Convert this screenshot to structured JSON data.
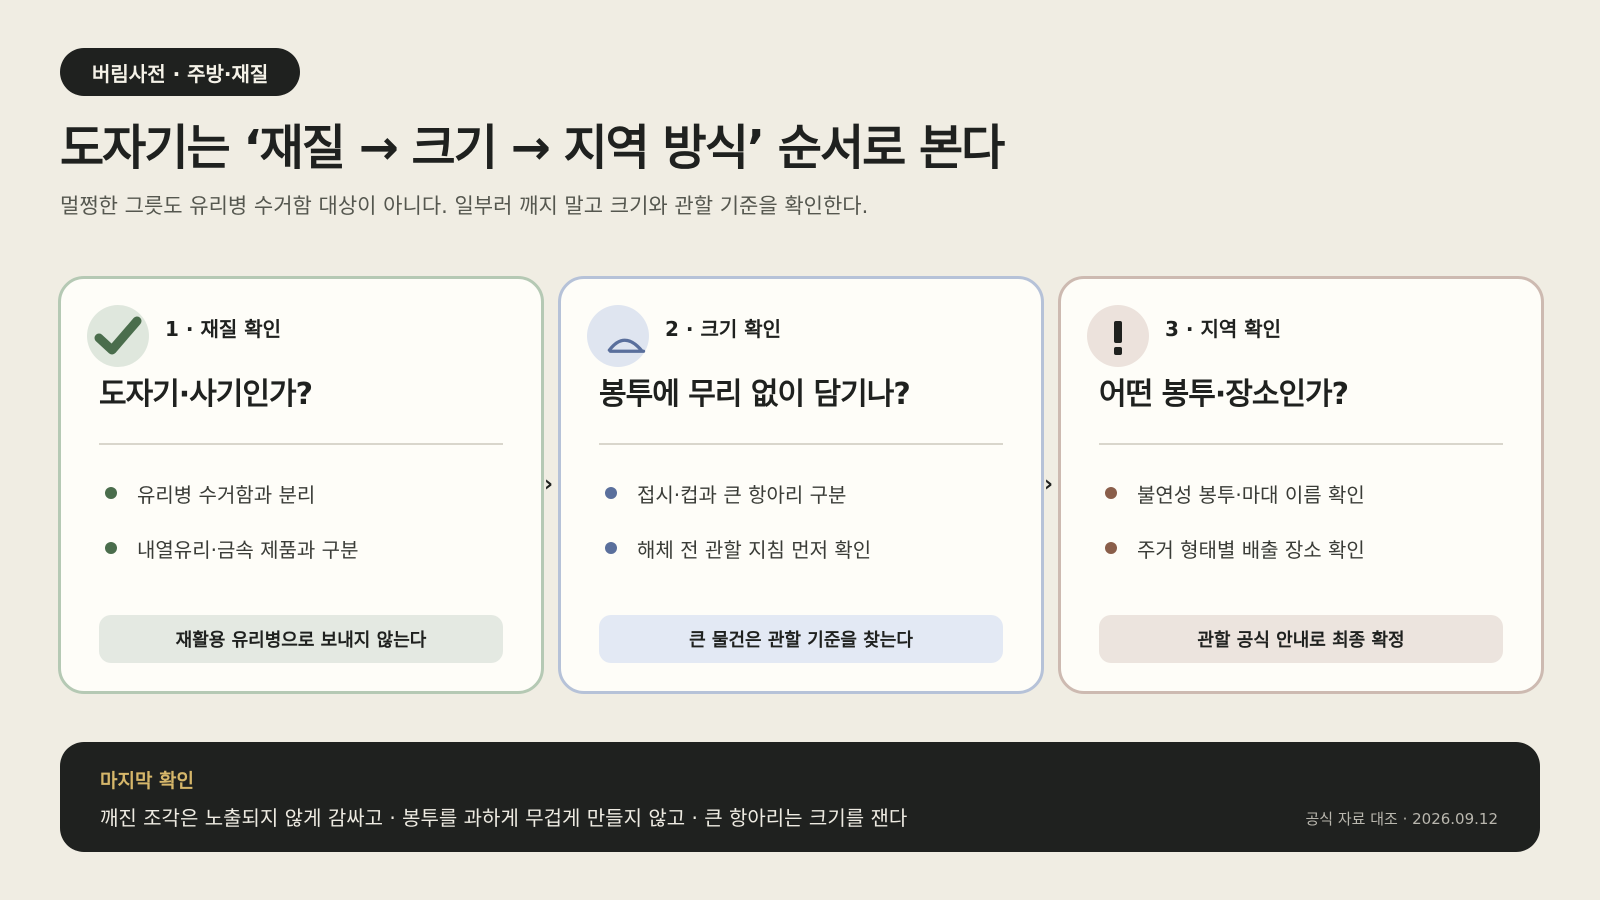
{
  "badge": "버림사전 · 주방·재질",
  "title": "도자기는 ‘재질 → 크기 → 지역 방식’ 순서로 본다",
  "subtitle": "멀쩡한 그릇도 유리병 수거함 대상이 아니다. 일부러 깨지 말고 크기와 관할 기준을 확인한다.",
  "cards": [
    {
      "icon": "check-icon",
      "step": "1 · 재질 확인",
      "question": "도자기·사기인가?",
      "bullets": [
        "유리병 수거함과 분리",
        "내열유리·금속 제품과 구분"
      ],
      "action": "재활용 유리병으로 보내지 않는다",
      "accent": "#4a6d4c"
    },
    {
      "icon": "bowl-icon",
      "step": "2 · 크기 확인",
      "question": "봉투에 무리 없이 담기나?",
      "bullets": [
        "접시·컵과 큰 항아리 구분",
        "해체 전 관할 지침 먼저 확인"
      ],
      "action": "큰 물건은 관할 기준을 찾는다",
      "accent": "#5a6f9c"
    },
    {
      "icon": "exclamation-icon",
      "step": "3 · 지역 확인",
      "question": "어떤 봉투·장소인가?",
      "bullets": [
        "불연성 봉투·마대 이름 확인",
        "주거 형태별 배출 장소 확인"
      ],
      "action": "관할 공식 안내로 최종 확정",
      "accent": "#8a5e4a"
    }
  ],
  "arrow_glyph": "›",
  "footer": {
    "label": "마지막 확인",
    "text": "깨진 조각은 노출되지 않게 감싸고 · 봉투를 과하게 무겁게 만들지 않고 · 큰 항아리는 크기를 잰다",
    "meta": "공식 자료 대조 · 2026.09.12"
  }
}
